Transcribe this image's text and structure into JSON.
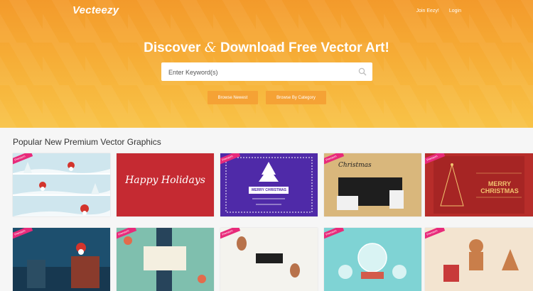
{
  "header": {
    "logo": "Vecteezy",
    "nav": [
      "Join Eezy!",
      "Login"
    ]
  },
  "hero": {
    "headline_part1": "Discover",
    "headline_amp": "&",
    "headline_part2": "Download Free Vector Art!",
    "search_placeholder": "Enter Keyword(s)",
    "buttons": [
      "Browse Newest",
      "Browse By Category"
    ]
  },
  "section": {
    "title": "Popular New Premium Vector Graphics"
  },
  "cards": [
    {
      "badge": "Premium",
      "text": ""
    },
    {
      "badge": "",
      "text": "Happy Holidays"
    },
    {
      "badge": "Premium",
      "text": "MERRY CHRISTMAS"
    },
    {
      "badge": "Premium",
      "text": "Christmas"
    },
    {
      "badge": "Premium",
      "text": "MERRY CHRISTMAS"
    },
    {
      "badge": "Premium",
      "text": ""
    },
    {
      "badge": "Premium",
      "text": ""
    },
    {
      "badge": "Premium",
      "text": ""
    },
    {
      "badge": "Premium",
      "text": ""
    },
    {
      "badge": "Premium",
      "text": ""
    }
  ],
  "colors": {
    "hero_top": "#f39a2b",
    "hero_bottom": "#f8c347",
    "button": "#f5a235",
    "badge": "#e82a7a"
  }
}
